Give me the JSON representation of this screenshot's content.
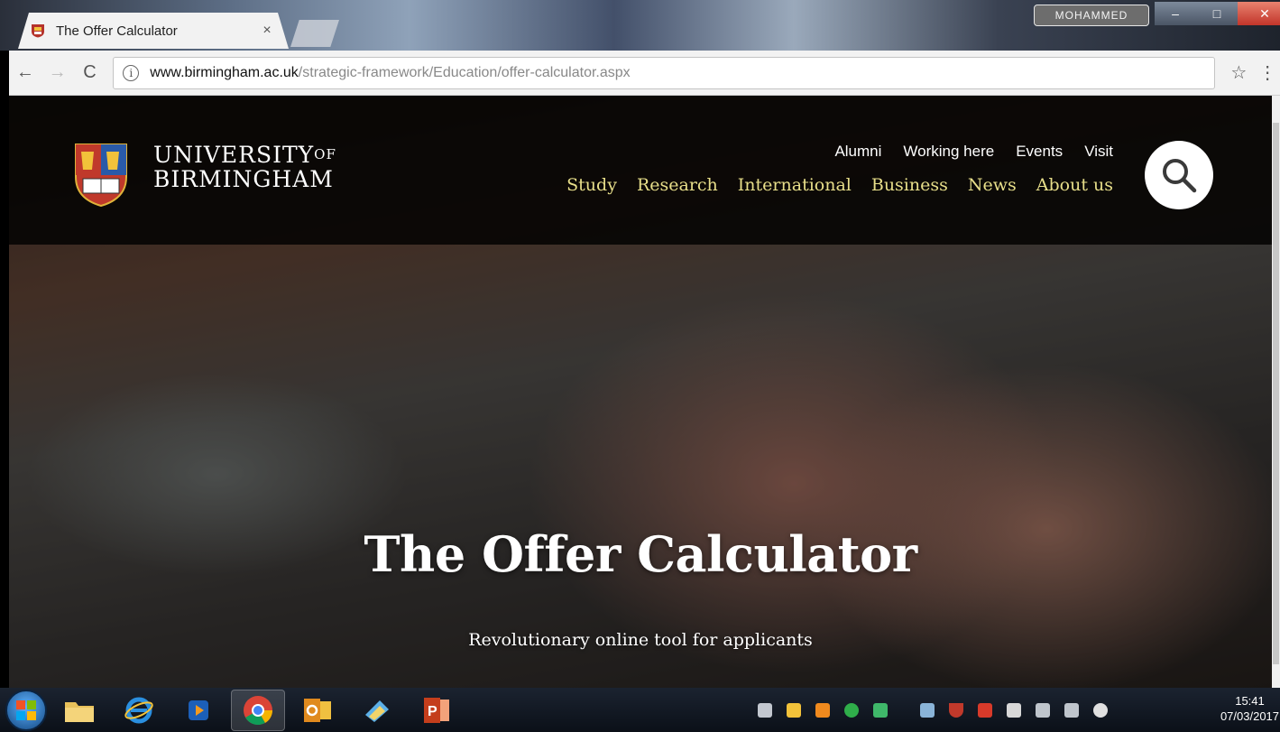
{
  "browser": {
    "tab_title": "The Offer Calculator",
    "tab_close": "×",
    "user_button": "MOHAMMED",
    "window_min": "–",
    "window_max": "□",
    "window_close": "✕",
    "nav_back": "←",
    "nav_forward": "→",
    "nav_reload": "C",
    "url_domain": "www.birmingham.ac.uk",
    "url_path": "/strategic-framework/Education/offer-calculator.aspx",
    "bookmark_star": "☆",
    "menu": "⋮"
  },
  "site": {
    "logo_line1": "UNIVERSITY",
    "logo_of": "OF",
    "logo_line2": "BIRMINGHAM",
    "utility_nav": [
      "Alumni",
      "Working here",
      "Events",
      "Visit"
    ],
    "main_nav": [
      "Study",
      "Research",
      "International",
      "Business",
      "News",
      "About us"
    ],
    "colors": {
      "header_bg": "#050302",
      "nav_gold": "#e8df8a"
    }
  },
  "hero": {
    "title": "The Offer Calculator",
    "subtitle": "Revolutionary online tool for applicants"
  },
  "taskbar": {
    "apps": [
      "file-explorer",
      "internet-explorer",
      "media-player",
      "chrome",
      "outlook",
      "snipping-tool",
      "powerpoint"
    ],
    "clock_time": "15:41",
    "clock_date": "07/03/2017"
  }
}
